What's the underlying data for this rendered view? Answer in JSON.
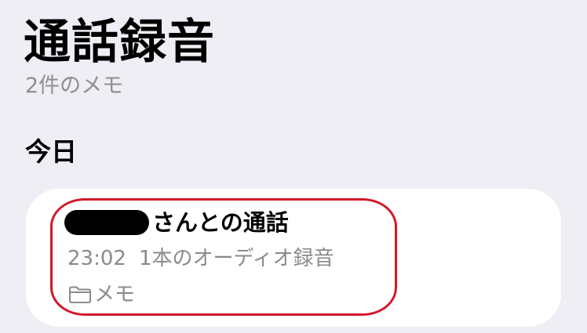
{
  "header": {
    "title": "通話録音",
    "subtitle": "2件のメモ"
  },
  "sections": [
    {
      "label": "今日",
      "notes": [
        {
          "title_suffix": "さんとの通話",
          "time": "23:02",
          "summary": "1本のオーディオ録音",
          "folder": "メモ",
          "folder_icon": "folder-icon",
          "redacted": true
        }
      ]
    }
  ],
  "colors": {
    "background": "#efeef4",
    "card": "#ffffff",
    "secondary_text": "#8e8e93",
    "highlight": "#d2192b"
  }
}
